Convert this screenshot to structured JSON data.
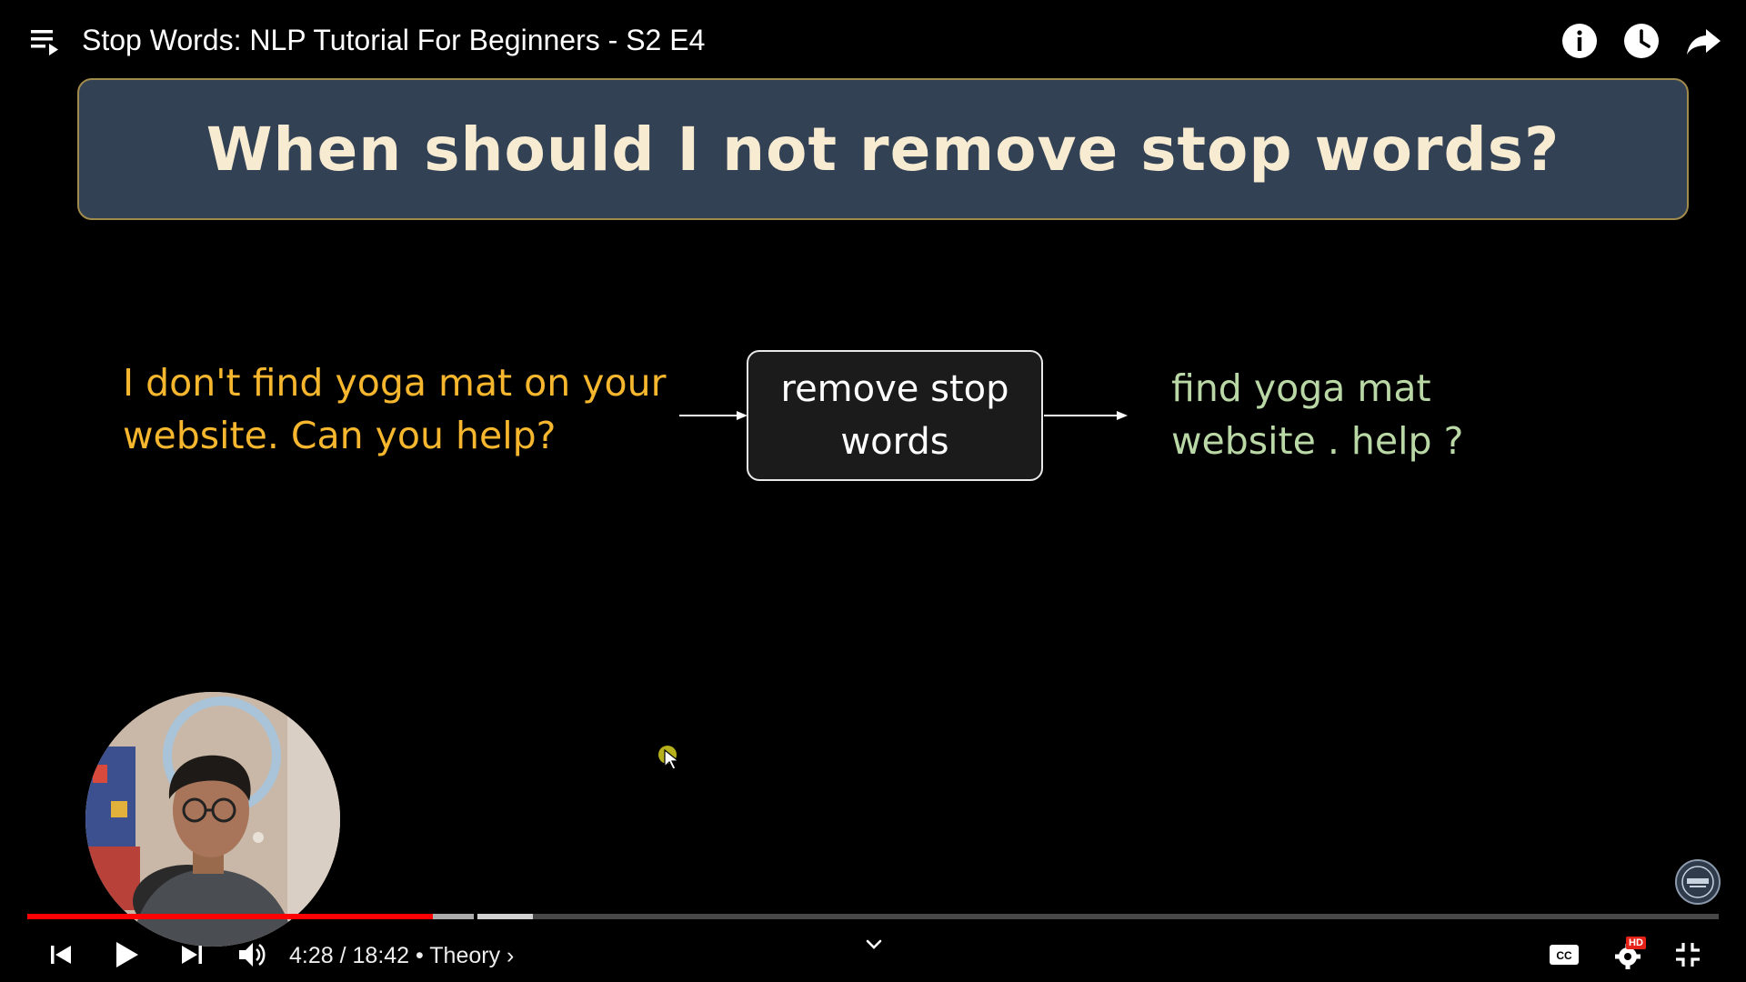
{
  "video": {
    "title": "Stop Words: NLP Tutorial For Beginners - S2 E4"
  },
  "top_controls": [
    "info-icon",
    "watch-later-icon",
    "share-icon"
  ],
  "slide": {
    "heading": "When should I not remove stop words?",
    "input_sentence": "I don't find yoga mat on your website. Can you help?",
    "process_label": "remove stop words",
    "output_sentence": "find yoga mat website . help ?",
    "colors": {
      "header_bg": "#334155",
      "heading_text": "#f7ecd2",
      "input_text": "#f6b72e",
      "output_text": "#b9d8a6"
    }
  },
  "playback": {
    "current_time": "4:28",
    "separator": " / ",
    "duration": "18:42",
    "chapter_prefix": " • ",
    "chapter": "Theory",
    "chapter_arrow": " ›",
    "played_fraction": 0.24,
    "buffered_fraction": 0.264,
    "hover_segment_fraction": [
      0.264,
      0.299
    ],
    "progress_color": "#ff0000"
  },
  "settings": {
    "quality_badge": "HD"
  }
}
